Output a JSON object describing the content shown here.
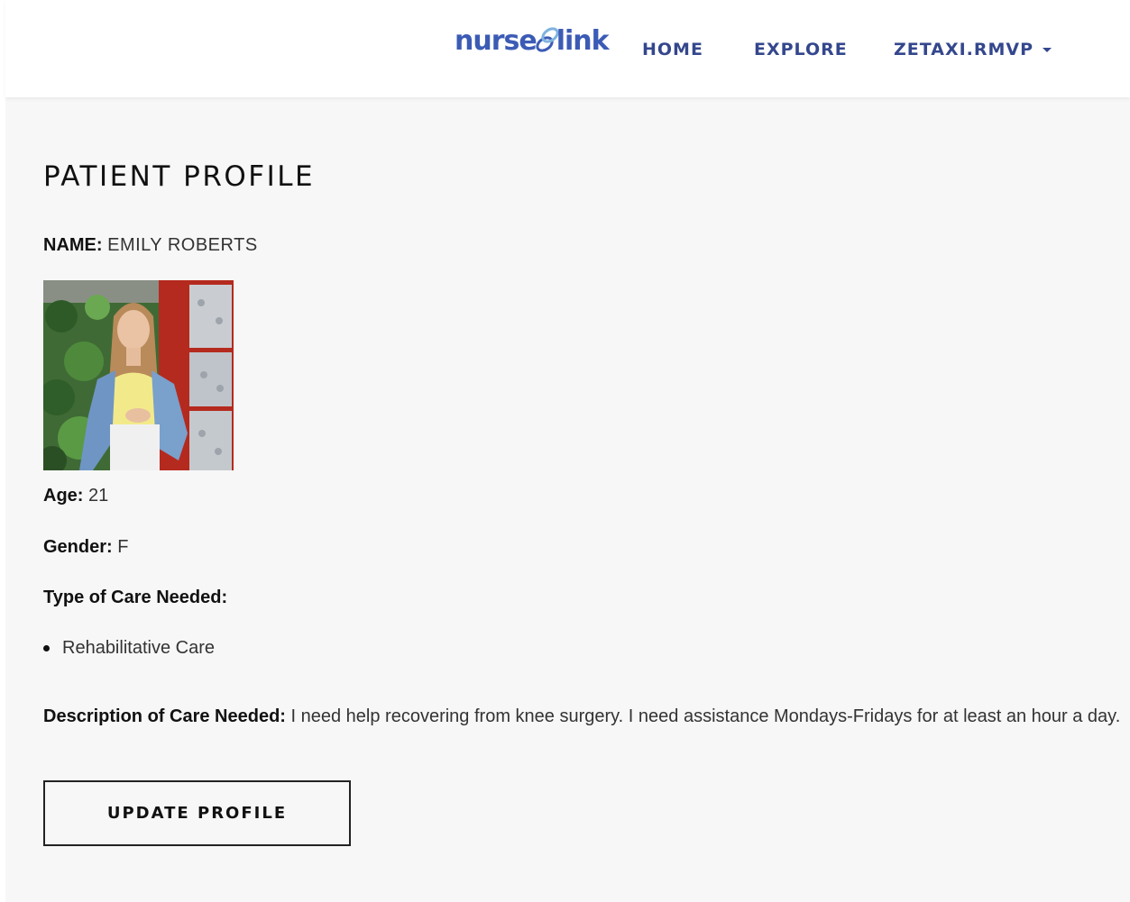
{
  "brand": {
    "logo_left": "nurse",
    "logo_right": "link",
    "color": "#3b5bb5"
  },
  "nav": {
    "home": "HOME",
    "explore": "EXPLORE",
    "user": "ZETAXI.RMVP",
    "link_color": "#34478d"
  },
  "profile": {
    "title": "PATIENT PROFILE",
    "name_label": "NAME:",
    "name_value": "EMILY ROBERTS",
    "age_label": "Age:",
    "age_value": "21",
    "gender_label": "Gender:",
    "gender_value": "F",
    "care_type_label": "Type of Care Needed:",
    "care_types": [
      "Rehabilitative Care"
    ],
    "description_label": "Description of Care Needed:",
    "description_value": "I need help recovering from knee surgery. I need assistance Mondays-Fridays for at least an hour a day.",
    "update_button": "UPDATE PROFILE"
  }
}
